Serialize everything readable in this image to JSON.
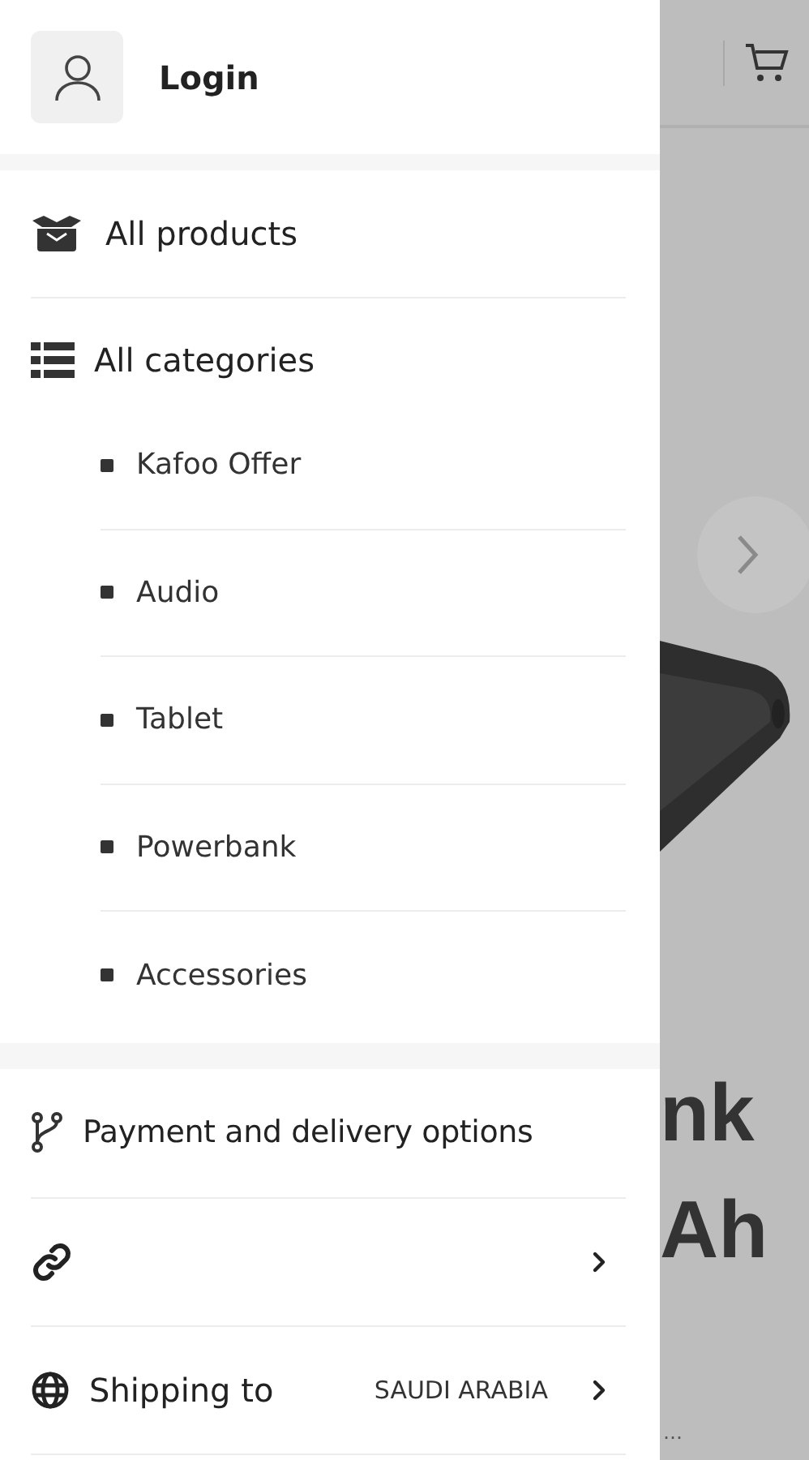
{
  "drawer": {
    "login": {
      "label": "Login"
    },
    "all_products": {
      "label": "All products"
    },
    "all_categories": {
      "label": "All categories",
      "children": [
        {
          "label": "Kafoo Offer"
        },
        {
          "label": "Audio"
        },
        {
          "label": "Tablet"
        },
        {
          "label": "Powerbank"
        },
        {
          "label": "Accessories"
        }
      ]
    },
    "payment_options": {
      "label": "Payment and delivery options"
    },
    "shipping": {
      "label": "Shipping to",
      "value": "SAUDI ARABIA"
    }
  },
  "background_page": {
    "headline_lines": [
      "nk",
      "Ah"
    ],
    "caption": "…"
  }
}
